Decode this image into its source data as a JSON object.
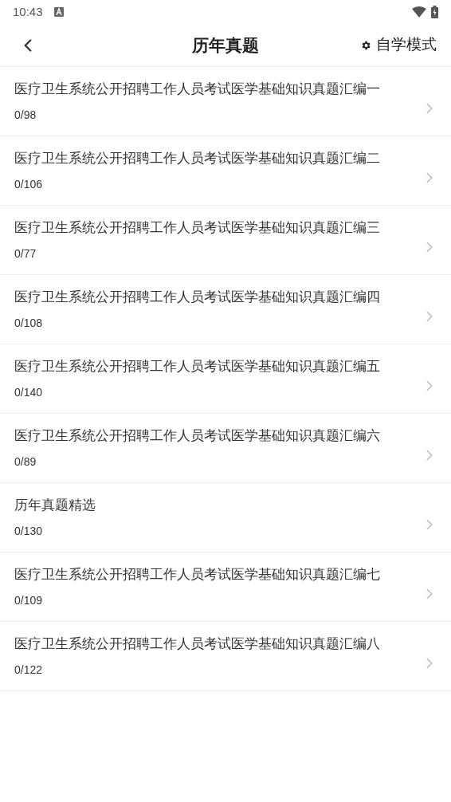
{
  "status_bar": {
    "time": "10:43"
  },
  "header": {
    "title": "历年真题",
    "mode_label": "自学模式"
  },
  "items": [
    {
      "title": "医疗卫生系统公开招聘工作人员考试医学基础知识真题汇编一",
      "progress": "0/98"
    },
    {
      "title": "医疗卫生系统公开招聘工作人员考试医学基础知识真题汇编二",
      "progress": "0/106"
    },
    {
      "title": "医疗卫生系统公开招聘工作人员考试医学基础知识真题汇编三",
      "progress": "0/77"
    },
    {
      "title": "医疗卫生系统公开招聘工作人员考试医学基础知识真题汇编四",
      "progress": "0/108"
    },
    {
      "title": "医疗卫生系统公开招聘工作人员考试医学基础知识真题汇编五",
      "progress": "0/140"
    },
    {
      "title": "医疗卫生系统公开招聘工作人员考试医学基础知识真题汇编六",
      "progress": "0/89"
    },
    {
      "title": "历年真题精选",
      "progress": "0/130"
    },
    {
      "title": "医疗卫生系统公开招聘工作人员考试医学基础知识真题汇编七",
      "progress": "0/109"
    },
    {
      "title": "医疗卫生系统公开招聘工作人员考试医学基础知识真题汇编八",
      "progress": "0/122"
    }
  ]
}
